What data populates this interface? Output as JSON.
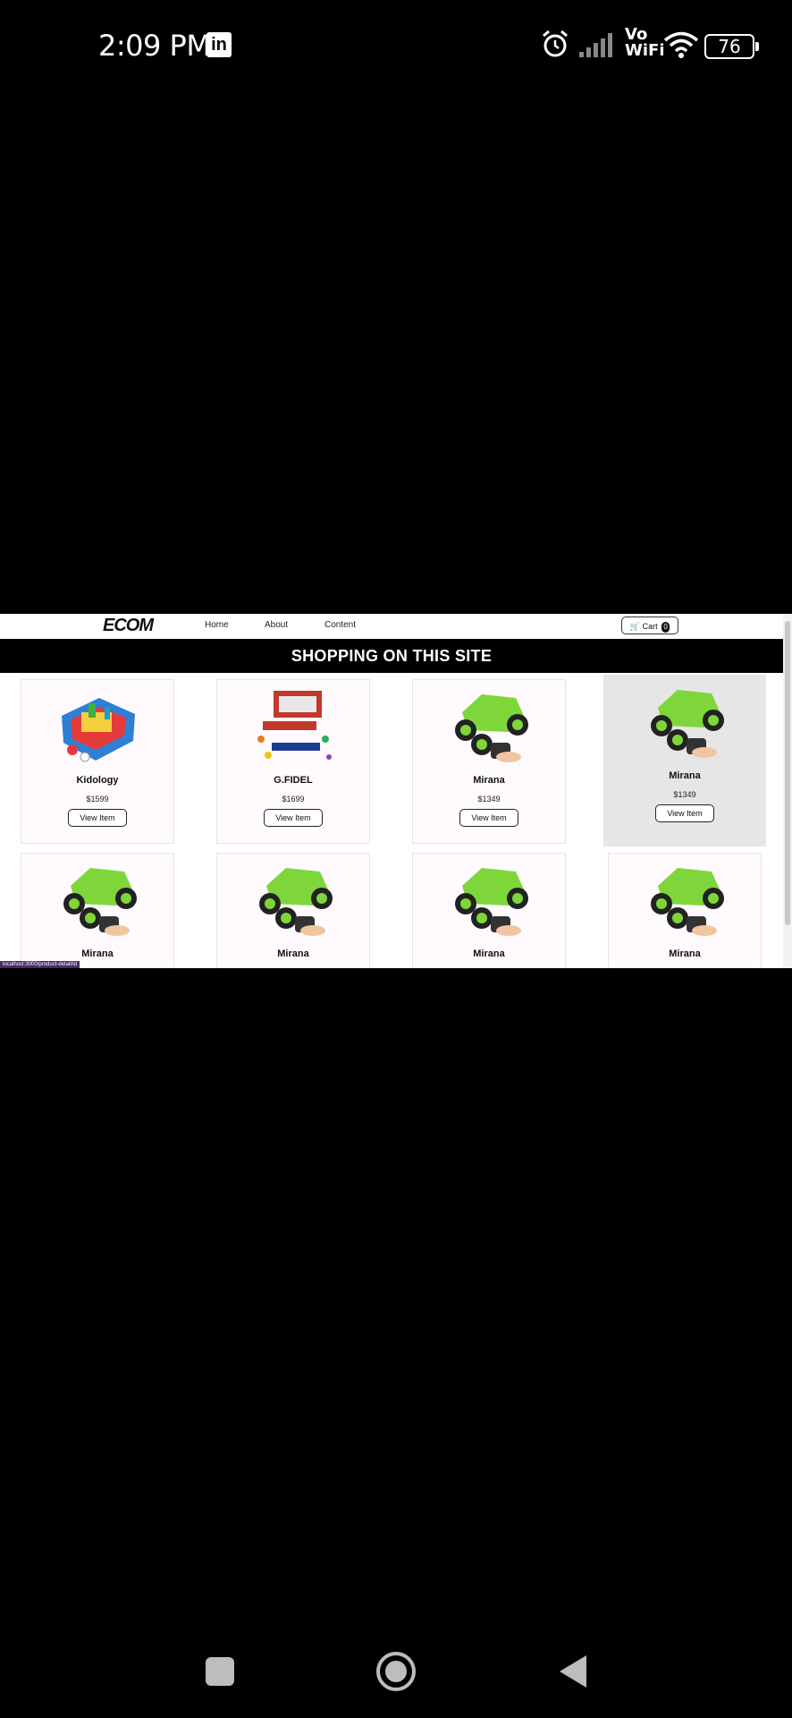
{
  "status_bar": {
    "time": "2:09 PM",
    "app_badge": "in",
    "network_label_1": "Vo",
    "network_label_2": "WiFi",
    "battery": "76"
  },
  "site": {
    "logo": "ECOM",
    "nav": [
      "Home",
      "About",
      "Content"
    ],
    "cart_label": "Cart",
    "cart_count": "0",
    "banner": "SHOPPING ON THIS SITE",
    "status_url": "localhost:3000/product-detail/id"
  },
  "products": [
    {
      "name": "Kidology",
      "price": "$1599",
      "button": "View Item",
      "image": "track-playset-icon"
    },
    {
      "name": "G.FIDEL",
      "price": "$1699",
      "button": "View Item",
      "image": "toy-truck-set-icon"
    },
    {
      "name": "Mirana",
      "price": "$1349",
      "button": "View Item",
      "image": "rc-car-icon"
    },
    {
      "name": "Mirana",
      "price": "$1349",
      "button": "View Item",
      "image": "rc-car-icon"
    },
    {
      "name": "Mirana",
      "price": "",
      "button": "",
      "image": "rc-car-icon"
    },
    {
      "name": "Mirana",
      "price": "",
      "button": "",
      "image": "rc-car-icon"
    },
    {
      "name": "Mirana",
      "price": "",
      "button": "",
      "image": "rc-car-icon"
    },
    {
      "name": "Mirana",
      "price": "",
      "button": "",
      "image": "rc-car-icon"
    }
  ],
  "colors": {
    "car_green": "#7fd63a",
    "banner_bg": "#000000",
    "hover_card": "#e6e6e6"
  }
}
